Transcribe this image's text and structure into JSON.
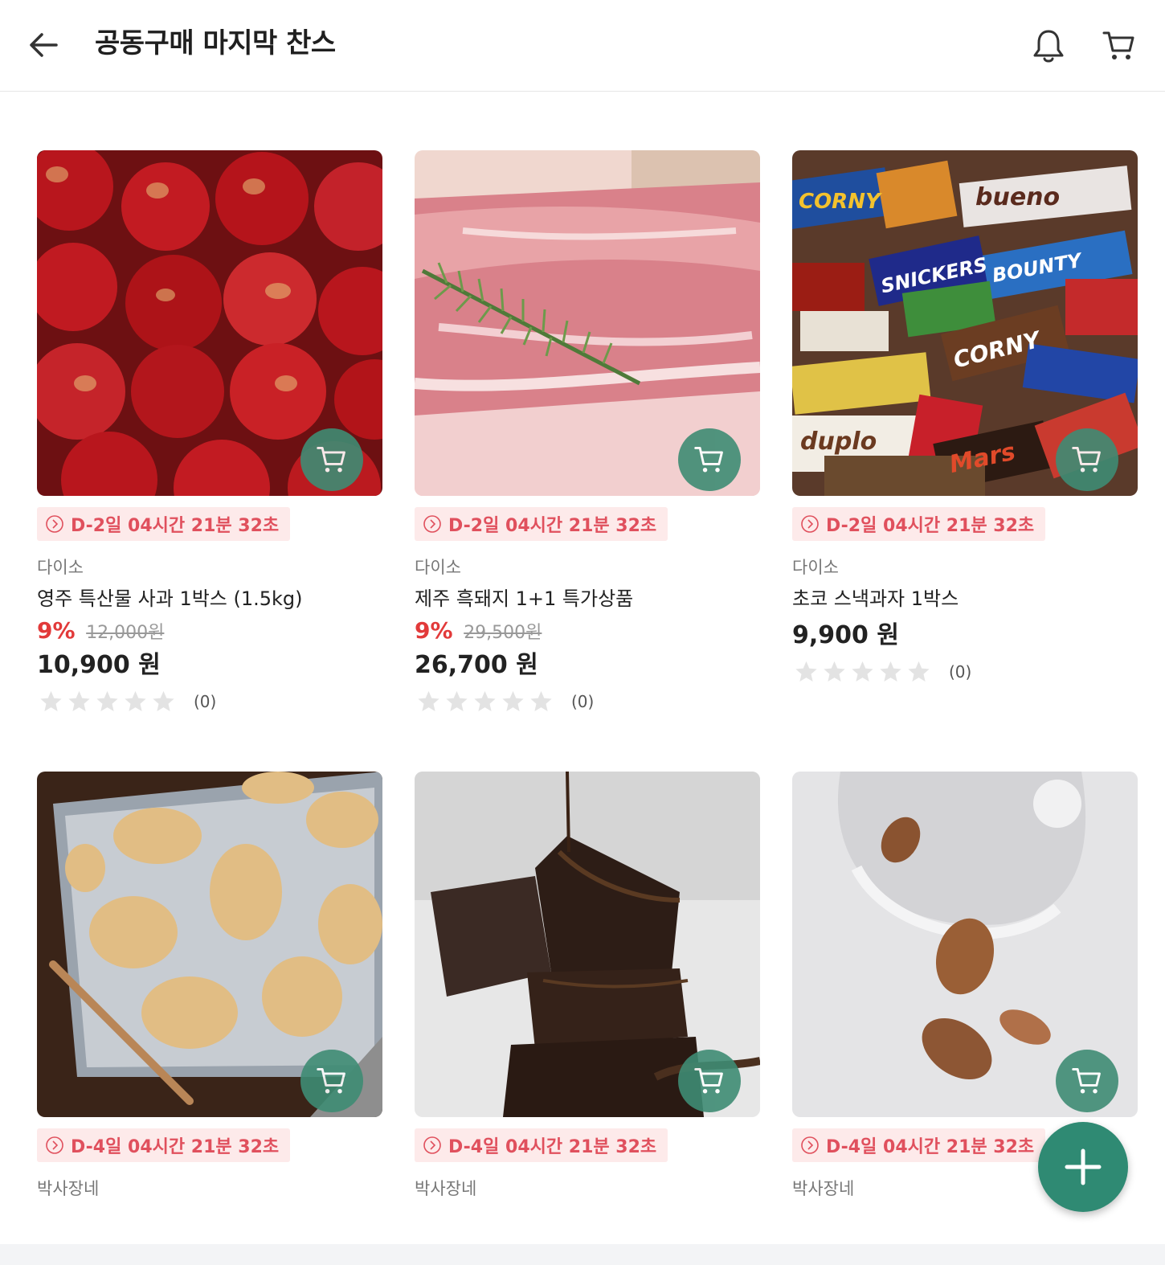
{
  "header": {
    "title": "공동구매 마지막 찬스",
    "back_icon": "arrow-left-icon",
    "bell_icon": "bell-icon",
    "cart_icon": "cart-icon"
  },
  "colors": {
    "accent_green": "#3f8c74",
    "deadline_red": "#e0505d",
    "deadline_bg": "#fdeaea",
    "discount_red": "#e23a3a"
  },
  "products": [
    {
      "deadline": "D-2일 04시간 21분 32초",
      "seller": "다이소",
      "name": "영주 특산물 사과 1박스 (1.5kg)",
      "discount": "9%",
      "original_price": "12,000원",
      "price": "10,900 원",
      "rating": 0,
      "review_count": "(0)",
      "image": "apples"
    },
    {
      "deadline": "D-2일 04시간 21분 32초",
      "seller": "다이소",
      "name": "제주 흑돼지 1+1 특가상품",
      "discount": "9%",
      "original_price": "29,500원",
      "price": "26,700 원",
      "rating": 0,
      "review_count": "(0)",
      "image": "pork-meat"
    },
    {
      "deadline": "D-2일 04시간 21분 32초",
      "seller": "다이소",
      "name": "초코 스낵과자 1박스",
      "price": "9,900 원",
      "rating": 0,
      "review_count": "(0)",
      "image": "chocolate-bars"
    },
    {
      "deadline": "D-4일 04시간 21분 32초",
      "seller": "박사장네",
      "image": "cookies"
    },
    {
      "deadline": "D-4일 04시간 21분 32초",
      "seller": "박사장네",
      "image": "brownie"
    },
    {
      "deadline": "D-4일 04시간 21분 32초",
      "seller": "박사장네",
      "image": "almonds-milk"
    }
  ],
  "fab_icon": "plus-icon"
}
